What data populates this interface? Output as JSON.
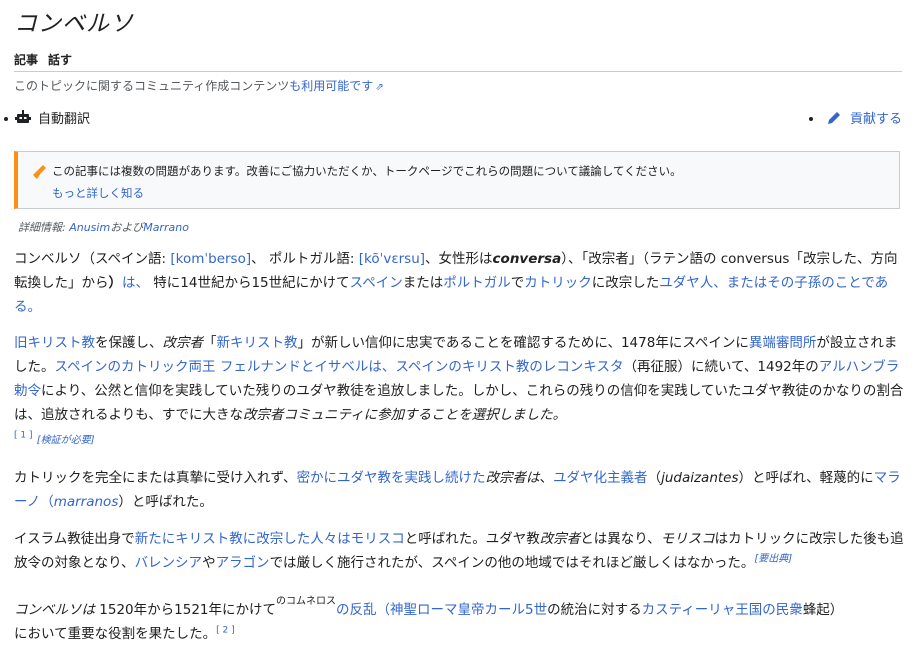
{
  "page_title": "コンベルソ",
  "tabs": {
    "article": "記事",
    "talk": "話す"
  },
  "topic_note": {
    "text": "このトピックに関するコミュニティ作成コンテンツ",
    "link": "も利用可能です"
  },
  "auto_translate": "自動翻訳",
  "contribute": "貢献する",
  "ambox": {
    "message": "この記事には複数の問題があります。改善にご協力いただくか、トークページでこれらの問題について議論してください。",
    "more": "もっと詳しく知る"
  },
  "detail": {
    "label": "詳細情報:",
    "link1": "Anusim",
    "mid": "および",
    "link2": "Marrano"
  },
  "p1": {
    "a": "コンベルソ（スペイン語: ",
    "ipa_es": "[komˈberso]",
    "b": "、 ポルトガル語: ",
    "ipa_pt": "[kõˈvɛrsu]",
    "c": "、女性形は",
    "fem": "conversa",
    "d": "）、「改宗者」（ラテン語の conversus「改宗した、方向転換した」から",
    "e": "）",
    "f": "は、",
    "g": " 特に14世紀から15世紀にかけて",
    "spain": "スペイン",
    "h": "または",
    "portugal": "ポルトガル",
    "i": "で",
    "catholic": "カトリック",
    "j": "に改宗した",
    "jews": "ユダヤ人、またはその子孫のこ",
    "k": "とである。"
  },
  "p2": {
    "old_christ": "旧キリスト教",
    "a": "を保護し、",
    "convert": "改宗者",
    "b": "「",
    "new_christ": "新キリスト教",
    "c": "」が新しい信仰に忠実であることを確認するために、1478年にスペインに",
    "inquisition": "異端審問所",
    "d": "が設立されました。",
    "kings": "スペインのカトリック両王 フェルナンドとイサベルは、スペインのキリスト教のレコンキスタ",
    "e": "（再征服）に続いて、1492年の",
    "alhambra": "アルハンブラ勅令",
    "f": "により、公然と信仰を実践していた残りのユダヤ教徒を追放しました。しかし、これらの残りの信仰を実践していたユダヤ教徒のかなりの割合は、追放されるよりも、すでに大きな",
    "g": "改宗者コミュニティに参加することを選択しました。",
    "ref1": "[ 1 ]",
    "verify": "[検証が必要]"
  },
  "p3": {
    "a": "カトリックを完全にまたは真摯に受け入れず、",
    "secret": "密かにユダヤ教を実践し続けた",
    "b": "改宗者は",
    "c": "、",
    "judaizer": "ユダヤ化主義者",
    "d": "（",
    "judaizantes": "judaizantes",
    "e": "）と呼ばれ、軽蔑的に",
    "marrano": "マラーノ（",
    "marranos": "marranos",
    "f": "）と呼ばれた。"
  },
  "p4": {
    "a": "イスラム教徒出身で",
    "new_converts": "新たにキリスト教に改宗した人々はモリスコ",
    "b": "と呼ばれた。ユダヤ教",
    "convert": "改宗者",
    "c": "とは異なり、",
    "morisco": "モリスコ",
    "d": "はカトリックに改宗した後も追放令の対象となり、",
    "valencia": "バレンシア",
    "e": "や",
    "aragon": "アラゴン",
    "f": "では厳しく施行されたが、スペインの他の地域ではそれほど厳しくはなかった。",
    "citation": "[要出典]"
  },
  "p5": {
    "conversos": "コンベルソは",
    "a": " 1520年から1521年にかけて",
    "ruby": "のコムネロス",
    "revolt": "の反乱（神聖ローマ皇帝カール5世",
    "b": "の統治に対する",
    "castile": "カスティーリャ王国の民衆",
    "c": "蜂起）",
    "d": "において重要な役割を果たした。",
    "ref2": "[ 2 ]"
  },
  "colors": {
    "link": "#3366cc",
    "warning": "#fc9012",
    "text": "#202122"
  }
}
